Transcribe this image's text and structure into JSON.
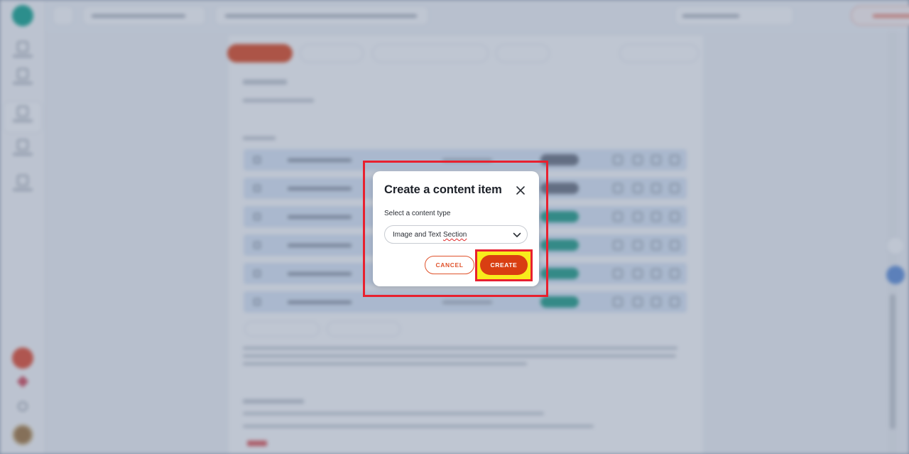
{
  "dialog": {
    "title": "Create a content item",
    "field_label": "Select a content type",
    "selected_type_prefix": "Image and Text ",
    "selected_type_misspelled": "Section",
    "cancel_label": "CANCEL",
    "create_label": "CREATE"
  },
  "icons": {
    "close": "close-icon",
    "dropdown": "chevron-down-icon"
  },
  "colors": {
    "accent": "#d93e12",
    "cancel_text": "#e0532c",
    "highlight_frame": "#e8212f",
    "highlight_fill": "#f8ec1c",
    "brand": "#12a58e"
  }
}
